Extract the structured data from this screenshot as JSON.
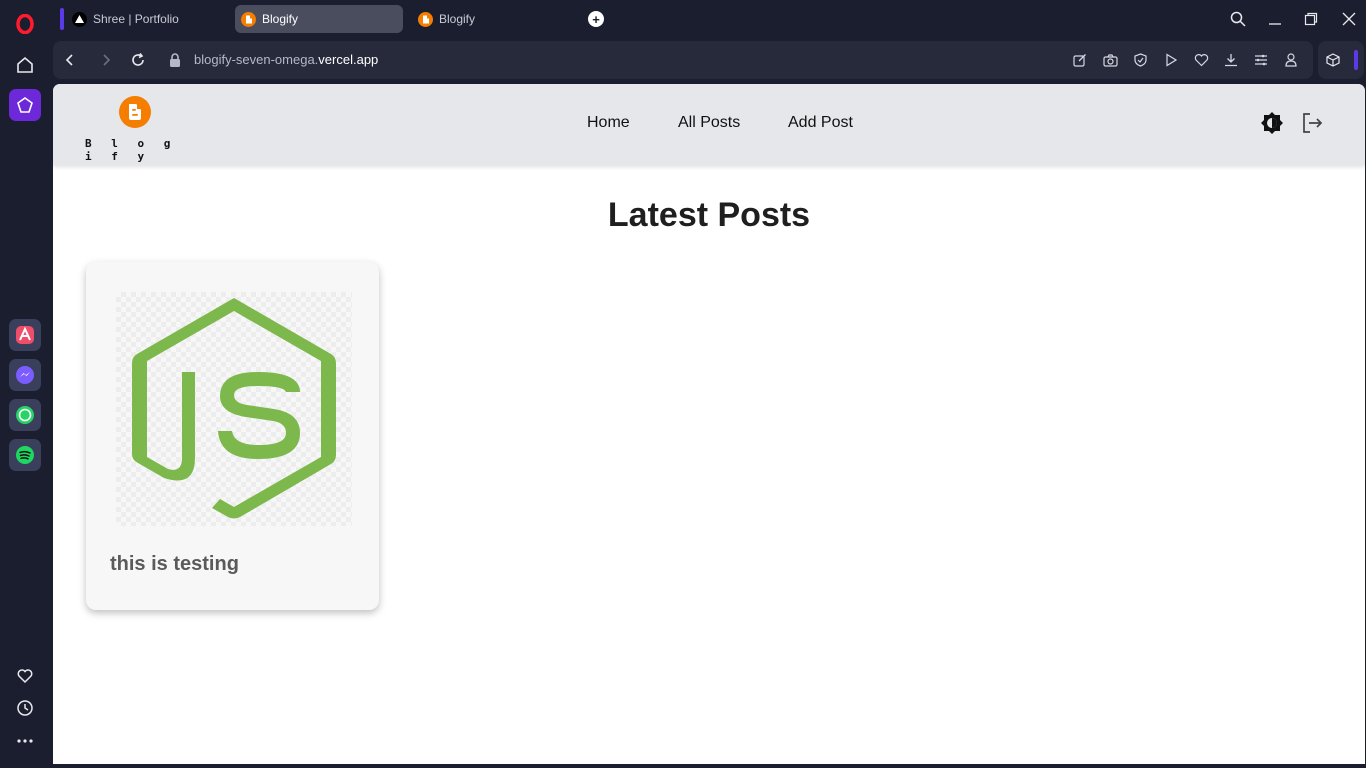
{
  "browser": {
    "tabs": [
      {
        "title": "Shree | Portfolio"
      },
      {
        "title": "Blogify"
      },
      {
        "title": "Blogify"
      }
    ],
    "url_prefix": "blogify-seven-omega.",
    "url_domain": "vercel.app",
    "sidebar_icons": [
      "opera-logo-icon",
      "home-icon",
      "spaces-icon",
      "aria-icon",
      "messenger-icon",
      "whatsapp-icon",
      "spotify-icon",
      "heart-icon",
      "history-icon",
      "more-icon"
    ],
    "accent_color": "#5b3be8"
  },
  "site": {
    "logo_text": "B l o g i f y",
    "nav": {
      "home": "Home",
      "all_posts": "All Posts",
      "add_post": "Add Post"
    },
    "heading": "Latest Posts",
    "posts": [
      {
        "title": "this is testing",
        "image": "nodejs-logo"
      }
    ],
    "brand_color": "#f57d00",
    "header_bg": "#e5e7eb"
  }
}
